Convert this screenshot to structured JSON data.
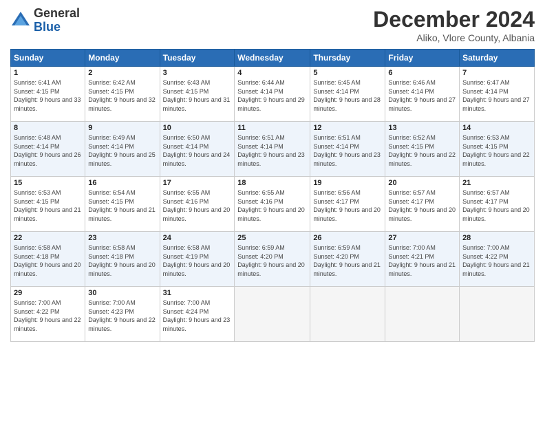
{
  "header": {
    "logo_line1": "General",
    "logo_line2": "Blue",
    "month": "December 2024",
    "location": "Aliko, Vlore County, Albania"
  },
  "weekdays": [
    "Sunday",
    "Monday",
    "Tuesday",
    "Wednesday",
    "Thursday",
    "Friday",
    "Saturday"
  ],
  "weeks": [
    [
      {
        "day": "1",
        "sunrise": "Sunrise: 6:41 AM",
        "sunset": "Sunset: 4:15 PM",
        "daylight": "Daylight: 9 hours and 33 minutes."
      },
      {
        "day": "2",
        "sunrise": "Sunrise: 6:42 AM",
        "sunset": "Sunset: 4:15 PM",
        "daylight": "Daylight: 9 hours and 32 minutes."
      },
      {
        "day": "3",
        "sunrise": "Sunrise: 6:43 AM",
        "sunset": "Sunset: 4:15 PM",
        "daylight": "Daylight: 9 hours and 31 minutes."
      },
      {
        "day": "4",
        "sunrise": "Sunrise: 6:44 AM",
        "sunset": "Sunset: 4:14 PM",
        "daylight": "Daylight: 9 hours and 29 minutes."
      },
      {
        "day": "5",
        "sunrise": "Sunrise: 6:45 AM",
        "sunset": "Sunset: 4:14 PM",
        "daylight": "Daylight: 9 hours and 28 minutes."
      },
      {
        "day": "6",
        "sunrise": "Sunrise: 6:46 AM",
        "sunset": "Sunset: 4:14 PM",
        "daylight": "Daylight: 9 hours and 27 minutes."
      },
      {
        "day": "7",
        "sunrise": "Sunrise: 6:47 AM",
        "sunset": "Sunset: 4:14 PM",
        "daylight": "Daylight: 9 hours and 27 minutes."
      }
    ],
    [
      {
        "day": "8",
        "sunrise": "Sunrise: 6:48 AM",
        "sunset": "Sunset: 4:14 PM",
        "daylight": "Daylight: 9 hours and 26 minutes."
      },
      {
        "day": "9",
        "sunrise": "Sunrise: 6:49 AM",
        "sunset": "Sunset: 4:14 PM",
        "daylight": "Daylight: 9 hours and 25 minutes."
      },
      {
        "day": "10",
        "sunrise": "Sunrise: 6:50 AM",
        "sunset": "Sunset: 4:14 PM",
        "daylight": "Daylight: 9 hours and 24 minutes."
      },
      {
        "day": "11",
        "sunrise": "Sunrise: 6:51 AM",
        "sunset": "Sunset: 4:14 PM",
        "daylight": "Daylight: 9 hours and 23 minutes."
      },
      {
        "day": "12",
        "sunrise": "Sunrise: 6:51 AM",
        "sunset": "Sunset: 4:14 PM",
        "daylight": "Daylight: 9 hours and 23 minutes."
      },
      {
        "day": "13",
        "sunrise": "Sunrise: 6:52 AM",
        "sunset": "Sunset: 4:15 PM",
        "daylight": "Daylight: 9 hours and 22 minutes."
      },
      {
        "day": "14",
        "sunrise": "Sunrise: 6:53 AM",
        "sunset": "Sunset: 4:15 PM",
        "daylight": "Daylight: 9 hours and 22 minutes."
      }
    ],
    [
      {
        "day": "15",
        "sunrise": "Sunrise: 6:53 AM",
        "sunset": "Sunset: 4:15 PM",
        "daylight": "Daylight: 9 hours and 21 minutes."
      },
      {
        "day": "16",
        "sunrise": "Sunrise: 6:54 AM",
        "sunset": "Sunset: 4:15 PM",
        "daylight": "Daylight: 9 hours and 21 minutes."
      },
      {
        "day": "17",
        "sunrise": "Sunrise: 6:55 AM",
        "sunset": "Sunset: 4:16 PM",
        "daylight": "Daylight: 9 hours and 20 minutes."
      },
      {
        "day": "18",
        "sunrise": "Sunrise: 6:55 AM",
        "sunset": "Sunset: 4:16 PM",
        "daylight": "Daylight: 9 hours and 20 minutes."
      },
      {
        "day": "19",
        "sunrise": "Sunrise: 6:56 AM",
        "sunset": "Sunset: 4:17 PM",
        "daylight": "Daylight: 9 hours and 20 minutes."
      },
      {
        "day": "20",
        "sunrise": "Sunrise: 6:57 AM",
        "sunset": "Sunset: 4:17 PM",
        "daylight": "Daylight: 9 hours and 20 minutes."
      },
      {
        "day": "21",
        "sunrise": "Sunrise: 6:57 AM",
        "sunset": "Sunset: 4:17 PM",
        "daylight": "Daylight: 9 hours and 20 minutes."
      }
    ],
    [
      {
        "day": "22",
        "sunrise": "Sunrise: 6:58 AM",
        "sunset": "Sunset: 4:18 PM",
        "daylight": "Daylight: 9 hours and 20 minutes."
      },
      {
        "day": "23",
        "sunrise": "Sunrise: 6:58 AM",
        "sunset": "Sunset: 4:18 PM",
        "daylight": "Daylight: 9 hours and 20 minutes."
      },
      {
        "day": "24",
        "sunrise": "Sunrise: 6:58 AM",
        "sunset": "Sunset: 4:19 PM",
        "daylight": "Daylight: 9 hours and 20 minutes."
      },
      {
        "day": "25",
        "sunrise": "Sunrise: 6:59 AM",
        "sunset": "Sunset: 4:20 PM",
        "daylight": "Daylight: 9 hours and 20 minutes."
      },
      {
        "day": "26",
        "sunrise": "Sunrise: 6:59 AM",
        "sunset": "Sunset: 4:20 PM",
        "daylight": "Daylight: 9 hours and 21 minutes."
      },
      {
        "day": "27",
        "sunrise": "Sunrise: 7:00 AM",
        "sunset": "Sunset: 4:21 PM",
        "daylight": "Daylight: 9 hours and 21 minutes."
      },
      {
        "day": "28",
        "sunrise": "Sunrise: 7:00 AM",
        "sunset": "Sunset: 4:22 PM",
        "daylight": "Daylight: 9 hours and 21 minutes."
      }
    ],
    [
      {
        "day": "29",
        "sunrise": "Sunrise: 7:00 AM",
        "sunset": "Sunset: 4:22 PM",
        "daylight": "Daylight: 9 hours and 22 minutes."
      },
      {
        "day": "30",
        "sunrise": "Sunrise: 7:00 AM",
        "sunset": "Sunset: 4:23 PM",
        "daylight": "Daylight: 9 hours and 22 minutes."
      },
      {
        "day": "31",
        "sunrise": "Sunrise: 7:00 AM",
        "sunset": "Sunset: 4:24 PM",
        "daylight": "Daylight: 9 hours and 23 minutes."
      },
      null,
      null,
      null,
      null
    ]
  ]
}
